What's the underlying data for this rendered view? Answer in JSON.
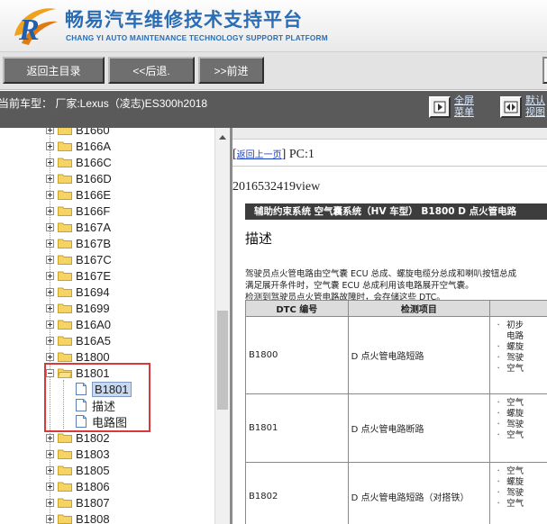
{
  "header": {
    "title_zh": "畅易汽车维修技术支持平台",
    "title_en": "CHANG YI AUTO MAINTENANCE TECHNOLOGY SUPPORT PLATFORM"
  },
  "toolbar": {
    "home_label": "返回主目录",
    "back_label": "<<后退.",
    "forward_label": ">>前进"
  },
  "status": {
    "vehicle_text": "当前车型：  厂家:Lexus（凌志)ES300h2018",
    "fullscreen_line1": "全屏",
    "fullscreen_line2": "菜单",
    "restore_line1": "默认",
    "restore_line2": "视图"
  },
  "tree": {
    "items": [
      {
        "label": "B1660",
        "type": "folder"
      },
      {
        "label": "B166A",
        "type": "folder"
      },
      {
        "label": "B166C",
        "type": "folder"
      },
      {
        "label": "B166D",
        "type": "folder"
      },
      {
        "label": "B166E",
        "type": "folder"
      },
      {
        "label": "B166F",
        "type": "folder"
      },
      {
        "label": "B167A",
        "type": "folder"
      },
      {
        "label": "B167B",
        "type": "folder"
      },
      {
        "label": "B167C",
        "type": "folder"
      },
      {
        "label": "B167E",
        "type": "folder"
      },
      {
        "label": "B1694",
        "type": "folder"
      },
      {
        "label": "B1699",
        "type": "folder"
      },
      {
        "label": "B16A0",
        "type": "folder"
      },
      {
        "label": "B16A5",
        "type": "folder"
      },
      {
        "label": "B1800",
        "type": "folder"
      },
      {
        "label": "B1801",
        "type": "folder-open"
      },
      {
        "label": "B1801",
        "type": "doc-selected"
      },
      {
        "label": "描述",
        "type": "doc"
      },
      {
        "label": "电路图",
        "type": "doc"
      },
      {
        "label": "B1802",
        "type": "folder"
      },
      {
        "label": "B1803",
        "type": "folder"
      },
      {
        "label": "B1805",
        "type": "folder"
      },
      {
        "label": "B1806",
        "type": "folder"
      },
      {
        "label": "B1807",
        "type": "folder"
      },
      {
        "label": "B1808",
        "type": "folder"
      }
    ]
  },
  "document": {
    "back_link": "返回上一页",
    "pc_text": "PC:1",
    "view_id": "2016532419view",
    "section_title": "辅助约束系统  空气囊系统（HV 车型）  B1800  D 点火管电路",
    "desc_title": "描述",
    "paragraphs": [
      "驾驶员点火管电路由空气囊 ECU 总成、螺旋电缆分总成和喇叭按钮总成",
      "满足展开条件时，空气囊 ECU 总成利用该电路展开空气囊。",
      "检测到驾驶员点火管电路故障时，会存储这些 DTC。"
    ],
    "table": {
      "headers": [
        "DTC 编号",
        "检测项目",
        ""
      ],
      "rows": [
        {
          "code": "B1800",
          "item": "D 点火管电路短路",
          "conditions": [
            "初步",
            "电路",
            "螺旋",
            "驾驶",
            "空气"
          ]
        },
        {
          "code": "B1801",
          "item": "D 点火管电路断路",
          "conditions": [
            "空气",
            "螺旋",
            "驾驶",
            "空气"
          ]
        },
        {
          "code": "B1802",
          "item": "D 点火管电路短路（对搭铁）",
          "conditions": [
            "空气",
            "螺旋",
            "驾驶",
            "空气"
          ]
        }
      ]
    }
  }
}
